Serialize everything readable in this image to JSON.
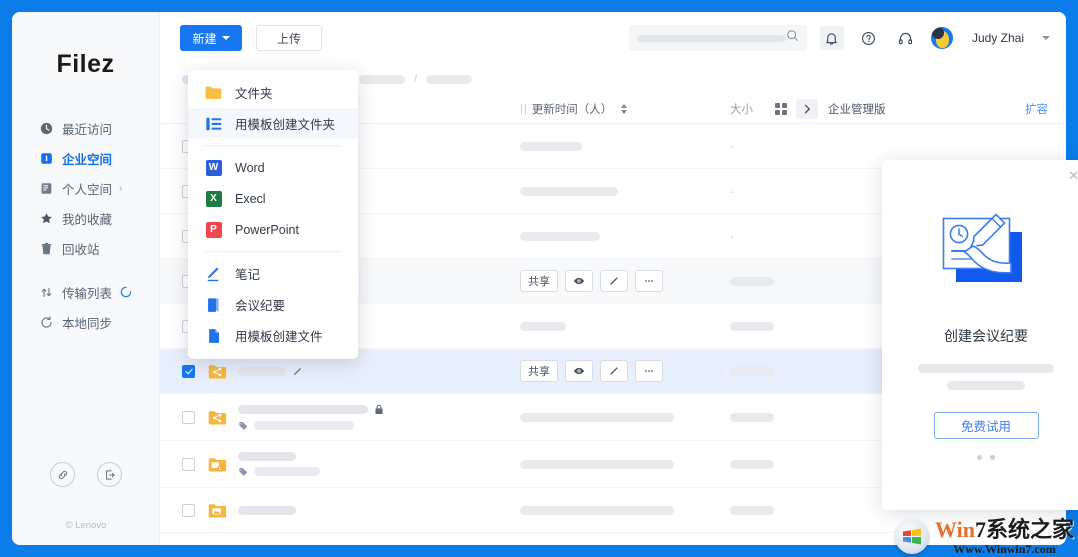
{
  "app": {
    "brand": "Filez",
    "copyright": "© Lenovo",
    "accent_blue": "#1876f2",
    "window_bg_blue": "#0b7ce8"
  },
  "sidebar": {
    "items": [
      {
        "label": "最近访问",
        "icon": "clock-icon",
        "active": false
      },
      {
        "label": "企业空间",
        "icon": "enterprise-icon",
        "active": true
      },
      {
        "label": "个人空间",
        "icon": "personal-space-icon",
        "active": false,
        "chevron": "›"
      },
      {
        "label": "我的收藏",
        "icon": "star-icon",
        "active": false
      },
      {
        "label": "回收站",
        "icon": "trash-icon",
        "active": false
      },
      {
        "label": "传输列表",
        "icon": "transfer-icon",
        "active": false,
        "spinner": true
      },
      {
        "label": "本地同步",
        "icon": "sync-icon",
        "active": false
      }
    ],
    "bottom_buttons": [
      {
        "name": "link-icon"
      },
      {
        "name": "logout-icon"
      }
    ]
  },
  "toolbar": {
    "new_label": "新建",
    "upload_label": "上传",
    "search_placeholder": "",
    "search_value": "",
    "icons": [
      {
        "name": "bell-icon"
      },
      {
        "name": "help-icon"
      },
      {
        "name": "headset-icon"
      }
    ],
    "user_name": "Judy Zhai"
  },
  "new_menu": {
    "items": [
      {
        "label": "文件夹",
        "icon": "folder-icon",
        "highlight": false,
        "divider_after": false
      },
      {
        "label": "用模板创建文件夹",
        "icon": "template-folder-icon",
        "highlight": true,
        "divider_after": true
      },
      {
        "label": "Word",
        "icon": "word-icon",
        "badge": "W",
        "color": "#2b5fd9",
        "highlight": false,
        "divider_after": false
      },
      {
        "label": "Execl",
        "icon": "excel-icon",
        "badge": "X",
        "color": "#1d7d45",
        "highlight": false,
        "divider_after": false
      },
      {
        "label": "PowerPoint",
        "icon": "powerpoint-icon",
        "badge": "P",
        "color": "#f0474c",
        "highlight": false,
        "divider_after": true
      },
      {
        "label": "笔记",
        "icon": "note-pencil-icon",
        "highlight": false,
        "divider_after": false
      },
      {
        "label": "会议纪要",
        "icon": "meeting-minutes-icon",
        "highlight": false,
        "divider_after": false
      },
      {
        "label": "用模板创建文件",
        "icon": "template-file-icon",
        "highlight": false,
        "divider_after": false
      }
    ]
  },
  "breadcrumb": {
    "separator": "/",
    "crumbs": [
      "",
      "",
      "",
      "",
      ""
    ]
  },
  "column_header": {
    "time_label": "更新时间（人）",
    "size_label": "大小",
    "plan_label": "企业管理版",
    "expand_label": "扩容",
    "grid_view_icon": "grid-view-icon",
    "expand_panel_icon": "chevron-right-icon"
  },
  "file_rows": [
    {
      "id": "row-1",
      "checked": false,
      "icon": "",
      "name_width": 0,
      "has_actions": false,
      "time_width": 62,
      "size_text": "·",
      "alt": false,
      "sub": null,
      "lock": false,
      "tag": false
    },
    {
      "id": "row-2",
      "checked": false,
      "icon": "",
      "name_width": 112,
      "has_actions": false,
      "time_width": 98,
      "size_text": "·",
      "alt": false,
      "sub": null,
      "lock": false,
      "tag": false
    },
    {
      "id": "row-3",
      "checked": false,
      "icon": "",
      "name_width": 80,
      "has_actions": false,
      "time_width": 80,
      "size_text": "·",
      "alt": false,
      "sub": null,
      "lock": true,
      "tag": false
    },
    {
      "id": "row-4",
      "checked": false,
      "icon": "",
      "name_width": 70,
      "has_actions": true,
      "time_width": 0,
      "size_text": "",
      "size_width": 44,
      "alt": true,
      "sub": null,
      "lock": false,
      "tag": false
    },
    {
      "id": "row-5",
      "checked": false,
      "icon": "",
      "name_width": 30,
      "has_actions": false,
      "time_width": 46,
      "size_text": "",
      "size_width": 44,
      "alt": false,
      "sub": null,
      "lock": false,
      "tag": false
    },
    {
      "id": "row-6",
      "checked": true,
      "icon": "shared-folder-icon",
      "name_width": 48,
      "has_actions": true,
      "time_width": 0,
      "size_text": "",
      "size_width": 44,
      "alt": false,
      "selected": true,
      "sub": null,
      "lock": false,
      "tag": false,
      "pencil": true
    },
    {
      "id": "row-7",
      "checked": false,
      "icon": "shared-folder-icon",
      "name_width": 130,
      "has_actions": false,
      "time_width": 154,
      "size_text": "",
      "size_width": 44,
      "alt": false,
      "sub": 100,
      "lock": true,
      "tag": true
    },
    {
      "id": "row-8",
      "checked": false,
      "icon": "sync-folder-icon",
      "name_width": 58,
      "has_actions": false,
      "time_width": 154,
      "size_text": "",
      "size_width": 44,
      "alt": false,
      "sub": 66,
      "lock": false,
      "tag": true
    },
    {
      "id": "row-9",
      "checked": false,
      "icon": "image-folder-icon",
      "name_width": 58,
      "has_actions": false,
      "time_width": 154,
      "size_text": "",
      "size_width": 44,
      "alt": false,
      "sub": null,
      "lock": false,
      "tag": false
    }
  ],
  "file_row_actions": {
    "share_label": "共享",
    "preview_icon": "eye-icon",
    "edit_icon": "pencil-icon",
    "more_icon": "ellipsis-icon"
  },
  "promo_card": {
    "close_icon": "close-icon",
    "illustration": "hand-writing-minutes-illustration",
    "title": "创建会议纪要",
    "button_label": "免费试用",
    "dots": 2,
    "active_dot": 0
  },
  "watermark": {
    "main_pre": "Win",
    "main_num": "7",
    "main_post": "系统之家",
    "sub": "Www.Winwin7.com"
  }
}
